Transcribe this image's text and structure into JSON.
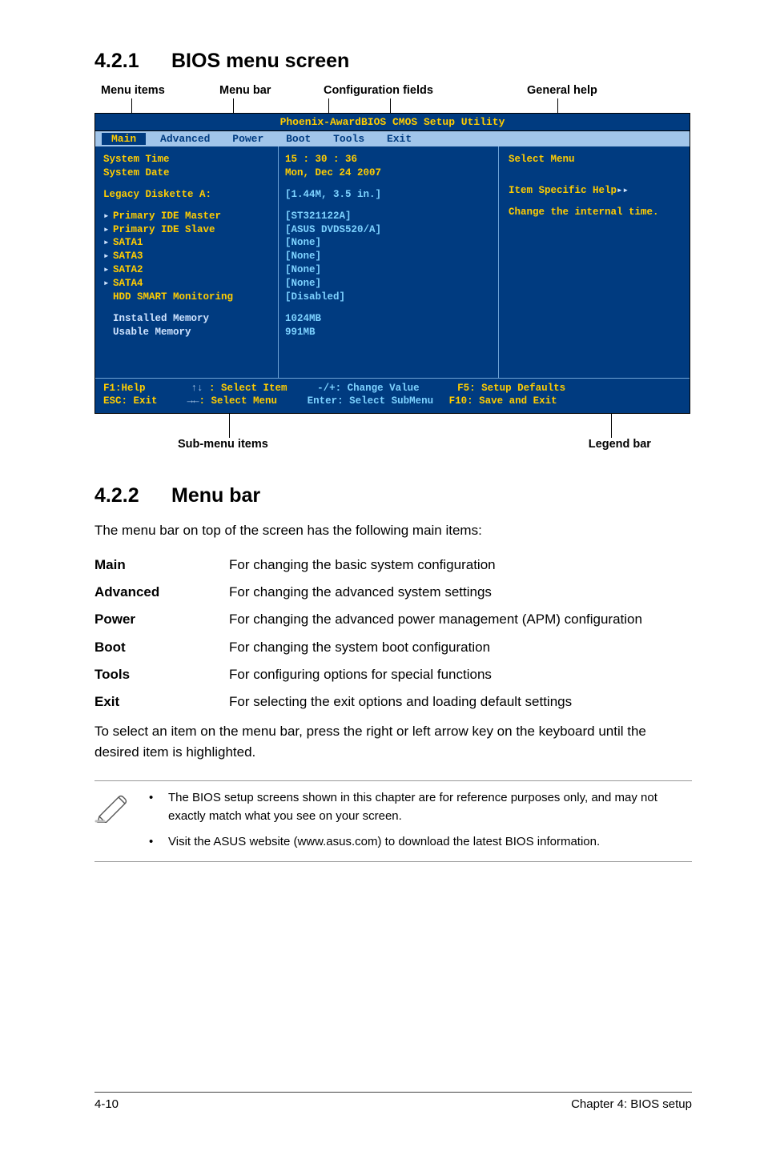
{
  "section1": {
    "num": "4.2.1",
    "title": "BIOS menu screen"
  },
  "topLabels": {
    "menuItems": "Menu items",
    "menuBar": "Menu bar",
    "configFields": "Configuration fields",
    "generalHelp": "General help"
  },
  "bios": {
    "title": "Phoenix-AwardBIOS CMOS Setup Utility",
    "tabs": {
      "main": "Main",
      "advanced": "Advanced",
      "power": "Power",
      "boot": "Boot",
      "tools": "Tools",
      "exit": "Exit"
    },
    "left": {
      "systemTime": "System Time",
      "systemDate": "System Date",
      "legacy": "Legacy Diskette A:",
      "pMaster": "Primary IDE Master",
      "pSlave": "Primary IDE Slave",
      "sata1": "SATA1",
      "sata3": "SATA3",
      "sata2": "SATA2",
      "sata4": "SATA4",
      "hdd": "HDD SMART Monitoring",
      "instMem": "Installed Memory",
      "usableMem": "Usable Memory"
    },
    "mid": {
      "time": "15 : 30 : 36",
      "date": "Mon, Dec 24 2007",
      "legacy": "[1.44M, 3.5 in.]",
      "pMaster": "[ST321122A]",
      "pSlave": "[ASUS DVDS520/A]",
      "sata1": "[None]",
      "sata3": "[None]",
      "sata2": "[None]",
      "sata4": "[None]",
      "hdd": "[Disabled]",
      "instMem": "1024MB",
      "usableMem": " 991MB"
    },
    "right": {
      "selectMenu": "Select Menu",
      "itemHelp": "Item Specific Help",
      "change": "Change the internal time."
    },
    "legend": {
      "l1a": "F1:Help",
      "l1b": ": Select Item",
      "l1c": "-/+: Change Value",
      "l1d": "F5: Setup Defaults",
      "l2a": "ESC: Exit",
      "l2b": ": Select Menu",
      "l2c": "Enter: Select SubMenu",
      "l2d": "F10: Save and Exit"
    }
  },
  "bottomLabels": {
    "sub": "Sub-menu items",
    "legend": "Legend bar"
  },
  "section2": {
    "num": "4.2.2",
    "title": "Menu bar"
  },
  "p1": "The menu bar on top of the screen has the following main items:",
  "defs": {
    "main": {
      "t": "Main",
      "d": "For changing the basic system configuration"
    },
    "adv": {
      "t": "Advanced",
      "d": "For changing the advanced system settings"
    },
    "pwr": {
      "t": "Power",
      "d": "For changing the advanced power management (APM) configuration"
    },
    "boot": {
      "t": "Boot",
      "d": "For changing the system boot configuration"
    },
    "tools": {
      "t": "Tools",
      "d": "For configuring options for special functions"
    },
    "exit": {
      "t": "Exit",
      "d": "For selecting the exit options and loading default settings"
    }
  },
  "p2": "To select an item on the menu bar, press the right or left arrow key on the keyboard until the desired item is highlighted.",
  "notes": {
    "n1": "The BIOS setup screens shown in this chapter are for reference purposes only, and may not exactly match what you see on your screen.",
    "n2": "Visit the ASUS website (www.asus.com) to download the latest BIOS information."
  },
  "footer": {
    "left": "4-10",
    "right": "Chapter 4: BIOS setup"
  }
}
